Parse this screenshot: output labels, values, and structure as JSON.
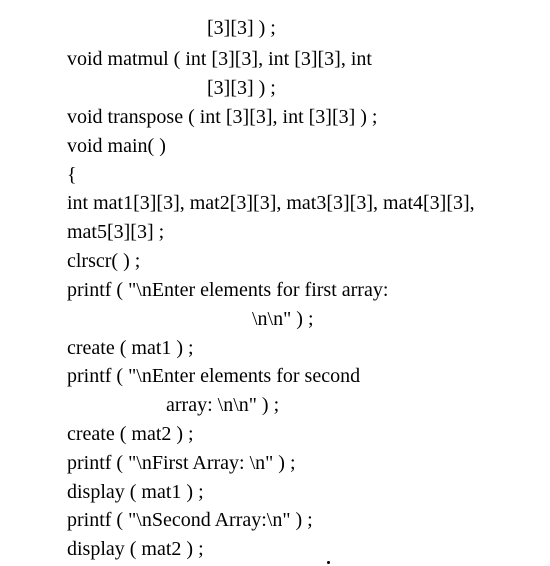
{
  "code_lines": [
    "[3][3] ) ;",
    "void matmul ( int [3][3], int [3][3], int",
    "[3][3] ) ;",
    "void transpose ( int [3][3], int [3][3] ) ;",
    "void main( )",
    "{",
    "int mat1[3][3], mat2[3][3], mat3[3][3], mat4[3][3],",
    "mat5[3][3] ;",
    "clrscr( ) ;",
    "printf ( \"\\nEnter elements for first array:",
    "\\n\\n\" ) ;",
    "create ( mat1 ) ;",
    "printf ( \"\\nEnter elements for second",
    "array: \\n\\n\" ) ;",
    "create ( mat2 ) ;",
    "printf ( \"\\nFirst Array: \\n\" ) ;",
    "display ( mat1 ) ;",
    "printf ( \"\\nSecond Array:\\n\" ) ;",
    "display ( mat2 ) ;"
  ]
}
